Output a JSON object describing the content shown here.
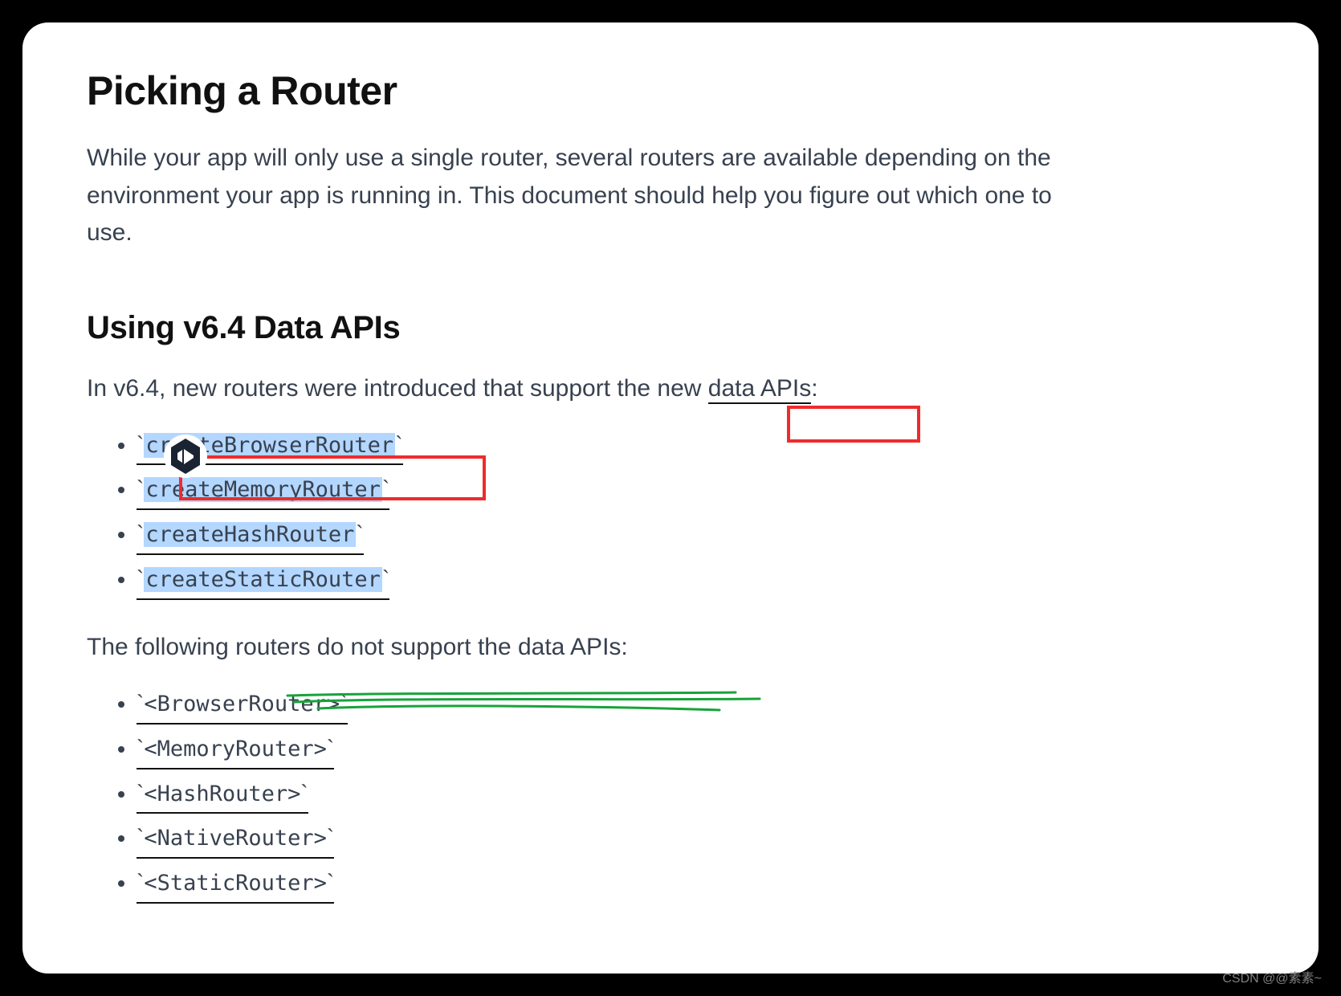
{
  "heading": "Picking a Router",
  "intro": "While your app will only use a single router, several routers are available depending on the environment your app is running in. This document should help you figure out which one to use.",
  "section": {
    "heading": "Using v6.4 Data APIs",
    "para_before_link": "In v6.4, new routers were introduced that support the new ",
    "link_text": "data APIs",
    "para_after_link": ":",
    "supported": [
      "createBrowserRouter",
      "createMemoryRouter",
      "createHashRouter",
      "createStaticRouter"
    ],
    "unsupported_para": "The following routers do not support the data APIs:",
    "unsupported": [
      "<BrowserRouter>",
      "<MemoryRouter>",
      "<HashRouter>",
      "<NativeRouter>",
      "<StaticRouter>"
    ]
  },
  "watermark": "CSDN @@素素~"
}
